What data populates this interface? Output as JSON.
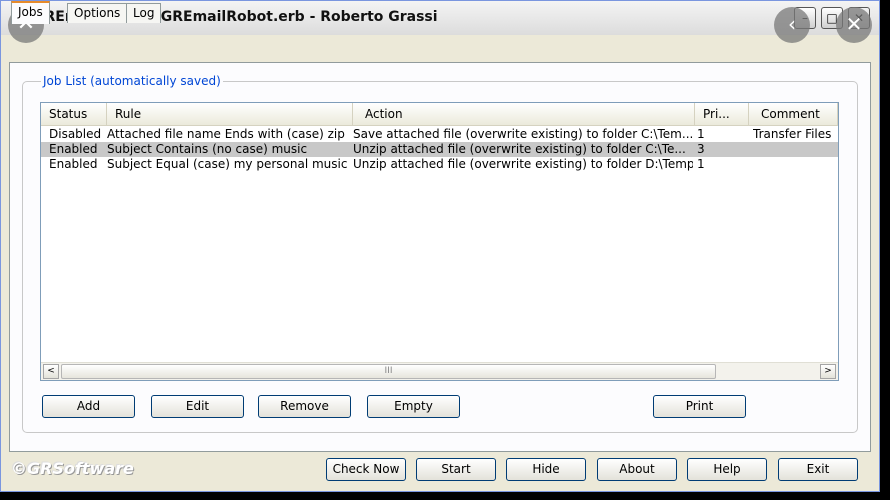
{
  "window": {
    "title": "GREmailRobot - GREmailRobot.erb - Roberto Grassi",
    "minimize_glyph": "–",
    "maximize_glyph": "□",
    "close_glyph": "✕"
  },
  "overlay": {
    "close_glyph": "✕",
    "right_glyphs": [
      "‹",
      "✕"
    ]
  },
  "tabs": [
    {
      "label": "Jobs",
      "active": true
    },
    {
      "label": "Options",
      "active": false
    },
    {
      "label": "Log",
      "active": false
    }
  ],
  "job_list": {
    "group_label": "Job List (automatically saved)",
    "columns": [
      "Status",
      "Rule",
      "Action",
      "Pri...",
      "Comment"
    ],
    "rows": [
      {
        "status": "Disabled",
        "rule": "Attached file name Ends with (case) zip",
        "action": "Save attached file (overwrite existing) to folder C:\\Tem...",
        "priority": "1",
        "comment": "Transfer Files",
        "selected": false
      },
      {
        "status": "Enabled",
        "rule": "Subject Contains (no case) music",
        "action": "Unzip attached file (overwrite existing) to folder C:\\Te...",
        "priority": "3",
        "comment": "",
        "selected": true
      },
      {
        "status": "Enabled",
        "rule": "Subject Equal (case) my personal music",
        "action": "Unzip attached file (overwrite existing) to folder D:\\Temp",
        "priority": "1",
        "comment": "",
        "selected": false
      }
    ],
    "scroll_left": "<",
    "scroll_right": ">",
    "scroll_grip": "III"
  },
  "list_buttons": {
    "add": "Add",
    "edit": "Edit",
    "remove": "Remove",
    "empty": "Empty",
    "print": "Print"
  },
  "footer": {
    "brand": "©GRSoftware",
    "check_now": "Check Now",
    "start": "Start",
    "hide": "Hide",
    "about": "About",
    "help": "Help",
    "exit": "Exit"
  }
}
